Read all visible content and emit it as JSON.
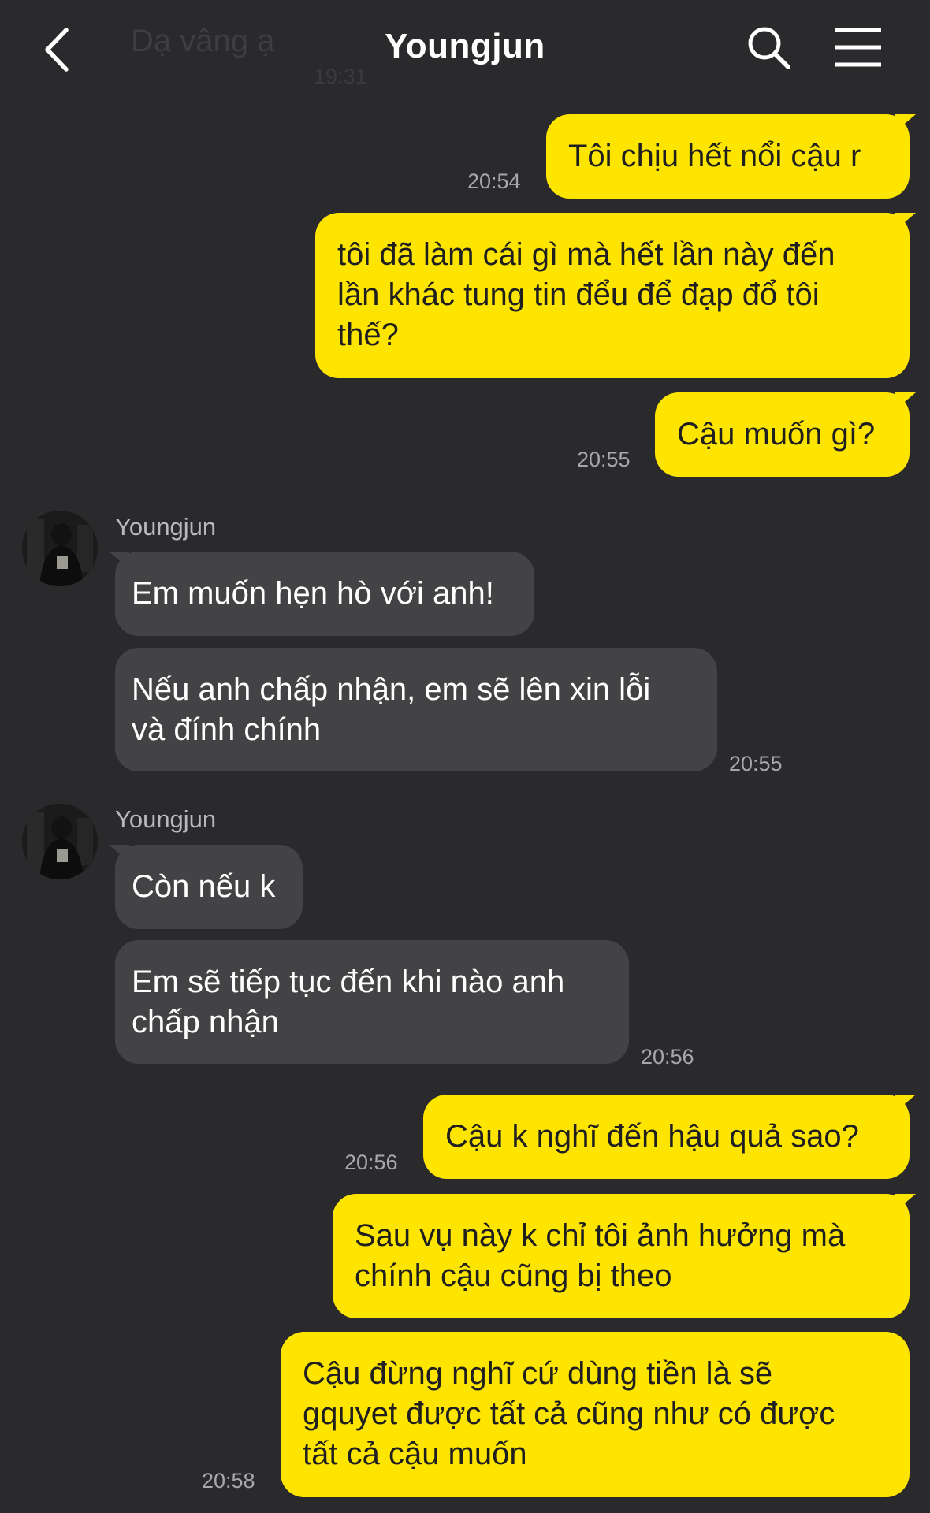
{
  "header": {
    "title": "Youngjun",
    "faded_prev_text": "Dạ vâng ạ",
    "faded_prev_time": "19:31",
    "icons": [
      "back-chevron-icon",
      "search-icon",
      "menu-icon"
    ]
  },
  "colors": {
    "background": "#2a2a2c",
    "my_bubble": "#fee500",
    "their_bubble": "#434345"
  },
  "messages": [
    {
      "from": "me",
      "text": "Tôi chịu hết nổi cậu r",
      "time": "20:54"
    },
    {
      "from": "me",
      "text": "tôi đã làm cái gì mà hết lần này đến\nlần khác tung tin đểu để đạp đổ tôi\nthế?"
    },
    {
      "from": "me",
      "text": "Cậu muốn gì?",
      "time": "20:55"
    },
    {
      "from": "them",
      "sender": "Youngjun",
      "text": "Em muốn hẹn hò với anh!"
    },
    {
      "from": "them",
      "text": "Nếu anh chấp nhận, em sẽ lên xin lỗi\nvà đính chính",
      "time": "20:55"
    },
    {
      "from": "them",
      "sender": "Youngjun",
      "text": "Còn nếu k"
    },
    {
      "from": "them",
      "text": "Em sẽ tiếp tục đến khi nào anh\nchấp nhận",
      "time": "20:56"
    },
    {
      "from": "me",
      "text": "Cậu k nghĩ đến hậu quả sao?",
      "time": "20:56"
    },
    {
      "from": "me",
      "text": "Sau vụ này k chỉ tôi ảnh hưởng mà\nchính cậu cũng bị theo"
    },
    {
      "from": "me",
      "text": "Cậu đừng nghĩ cứ dùng tiền là sẽ\ngquyet được tất cả cũng như có được\ntất cả cậu muốn",
      "time": "20:58"
    }
  ]
}
